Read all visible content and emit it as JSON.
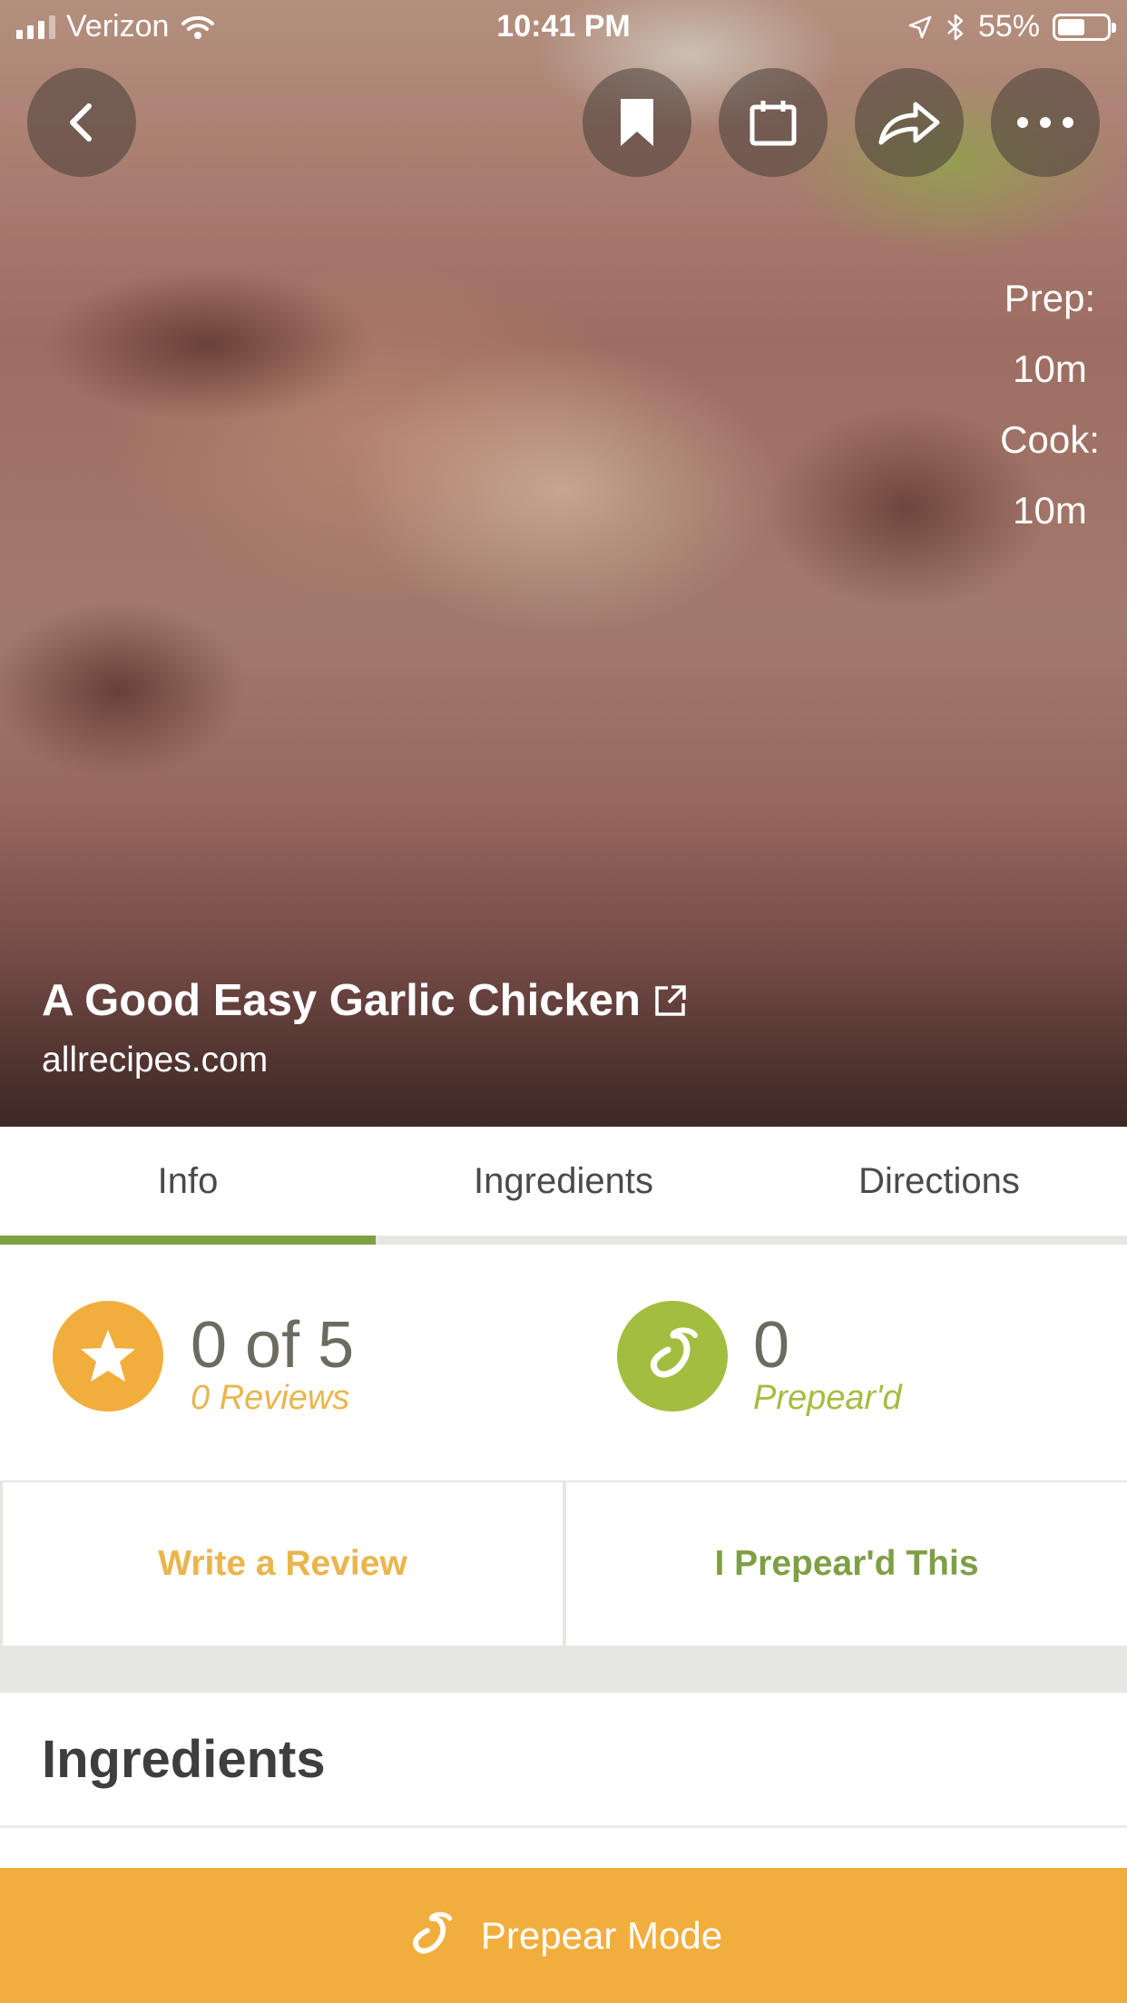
{
  "status_bar": {
    "carrier": "Verizon",
    "time": "10:41 PM",
    "battery": "55%",
    "battery_level": 0.55
  },
  "recipe": {
    "title": "A Good Easy Garlic Chicken",
    "source": "allrecipes.com",
    "prep_label": "Prep:",
    "prep_value": "10m",
    "cook_label": "Cook:",
    "cook_value": "10m"
  },
  "tabs": [
    {
      "label": "Info",
      "active": true
    },
    {
      "label": "Ingredients",
      "active": false
    },
    {
      "label": "Directions",
      "active": false
    }
  ],
  "stats": {
    "rating": "0 of 5",
    "reviews": "0 Reviews",
    "prepeard_count": "0",
    "prepeard_label": "Prepear'd"
  },
  "actions": {
    "write_review": "Write a Review",
    "prepeard_this": "I Prepear'd This"
  },
  "sections": {
    "ingredients_heading": "Ingredients"
  },
  "bottom_bar": {
    "label": "Prepear Mode"
  },
  "colors": {
    "accent_orange": "#f2ae3d",
    "accent_green": "#7f9f45",
    "prepeard_green": "#a3bd3f",
    "review_orange": "#e9b54c"
  },
  "icons": [
    "back-arrow-icon",
    "bookmark-icon",
    "calendar-icon",
    "share-icon",
    "more-icon",
    "external-link-icon",
    "star-icon",
    "pear-icon"
  ]
}
